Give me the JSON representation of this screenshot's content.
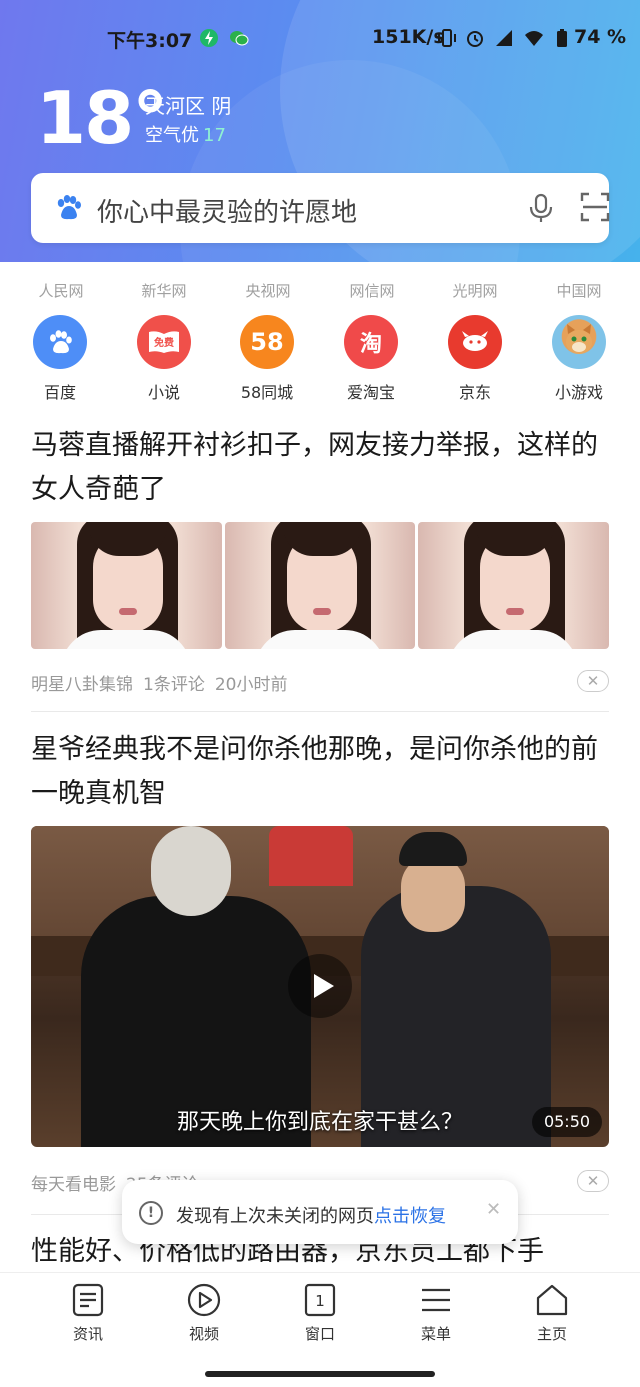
{
  "status_bar": {
    "time": "下午3:07",
    "speed": "151K/s",
    "battery": "74 %"
  },
  "weather": {
    "temperature": "18°",
    "location_weather": "天河区 阴",
    "air_label": "空气优",
    "air_value": "17"
  },
  "search": {
    "placeholder": "你心中最灵验的许愿地"
  },
  "site_links": [
    "人民网",
    "新华网",
    "央视网",
    "网信网",
    "光明网",
    "中国网"
  ],
  "apps": [
    {
      "name": "百度",
      "icon": "paw-icon",
      "color": "#4e8ef7"
    },
    {
      "name": "小说",
      "icon": "book-icon",
      "badge": "免费",
      "color": "#f0504a"
    },
    {
      "name": "58同城",
      "icon": "58-icon",
      "badge": "58",
      "color": "#f7861e"
    },
    {
      "name": "爱淘宝",
      "icon": "taobao-icon",
      "badge": "淘",
      "color": "#f04a4a"
    },
    {
      "name": "京东",
      "icon": "jd-dog-icon",
      "color": "#e83a2e"
    },
    {
      "name": "小游戏",
      "icon": "game-cat-icon",
      "color": "#7fc3e8"
    }
  ],
  "news": [
    {
      "title": "马蓉直播解开衬衫扣子，网友接力举报，这样的女人奇葩了",
      "source": "明星八卦集锦",
      "comments": "1条评论",
      "time": "20小时前"
    },
    {
      "title": "星爷经典我不是问你杀他那晚，是问你杀他的前一晚真机智",
      "subtitle": "那天晚上你到底在家干甚么？",
      "duration": "05:50",
      "source": "每天看电影",
      "comments": "25条评论"
    },
    {
      "title": "性能好、价格低的路由器，京东员工都下手"
    }
  ],
  "toast": {
    "message": "发现有上次未关闭的网页",
    "action": "点击恢复"
  },
  "bottom_nav": [
    {
      "label": "资讯",
      "icon": "news-icon"
    },
    {
      "label": "视频",
      "icon": "video-icon"
    },
    {
      "label": "窗口",
      "icon": "window-icon",
      "count": "1"
    },
    {
      "label": "菜单",
      "icon": "menu-icon"
    },
    {
      "label": "主页",
      "icon": "home-icon"
    }
  ]
}
